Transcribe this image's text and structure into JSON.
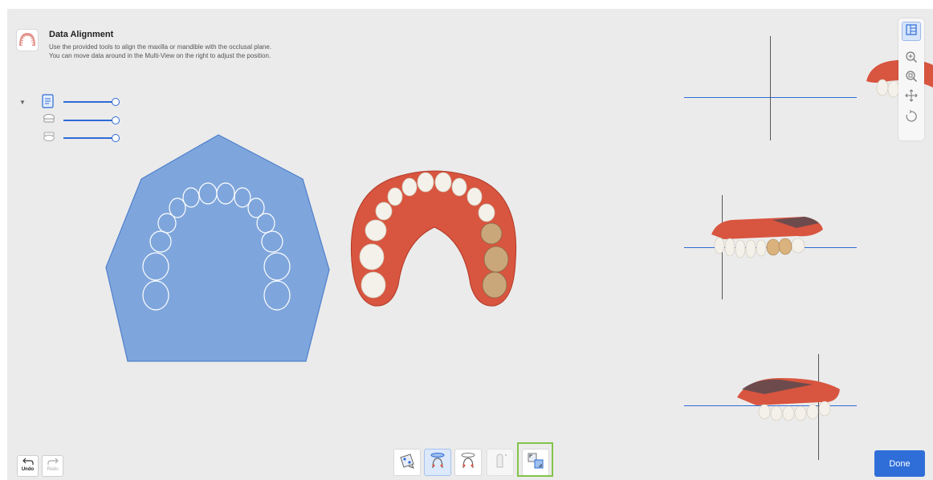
{
  "header": {
    "title": "Data Alignment",
    "description_line1": "Use the provided tools to align the maxilla or mandible with the occlusal plane.",
    "description_line2": "You can move data around in the Multi-View on the right to adjust the position."
  },
  "layers": [
    {
      "icon": "document-icon",
      "opacity": 1.0
    },
    {
      "icon": "maxilla-icon",
      "opacity": 1.0
    },
    {
      "icon": "mandible-icon",
      "opacity": 1.0
    }
  ],
  "right_toolbar": [
    "layout-icon",
    "zoom-in-icon",
    "zoom-fit-icon",
    "pan-icon",
    "rotate-icon"
  ],
  "undo": {
    "label": "Undo"
  },
  "redo": {
    "label": "Redo"
  },
  "bottom_tools": [
    {
      "name": "auto-align-tool",
      "state": "normal"
    },
    {
      "name": "occlusal-plane-maxilla-tool",
      "state": "selected"
    },
    {
      "name": "occlusal-plane-mandible-tool",
      "state": "normal"
    },
    {
      "name": "marker-tool",
      "state": "disabled"
    },
    {
      "name": "move-tool",
      "state": "highlighted"
    }
  ],
  "done": {
    "label": "Done"
  },
  "colors": {
    "accent": "#2f6ed8",
    "plane": "#7fa6dc",
    "gum": "#d8553f",
    "highlight": "#83c44a"
  }
}
